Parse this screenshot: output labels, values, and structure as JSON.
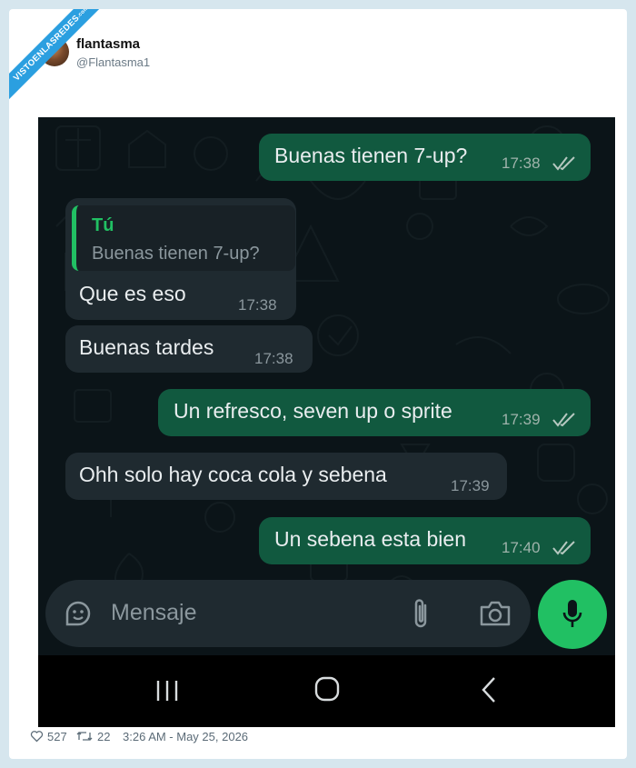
{
  "watermark": {
    "text": "VISTOENLASREDES",
    "suffix": ".com"
  },
  "tweet": {
    "author_name": "flantasma",
    "author_handle": "@Flantasma1",
    "likes": "527",
    "retweets": "22",
    "timestamp": "3:26 AM - May 25, 2026"
  },
  "chat": {
    "messages": [
      {
        "text": "Buenas tienen 7-up?",
        "time": "17:38",
        "direction": "outgoing",
        "status": "read"
      },
      {
        "text": "Que es eso",
        "time": "17:38",
        "direction": "incoming",
        "quote_author": "Tú",
        "quote_text": "Buenas tienen 7-up?"
      },
      {
        "text": "Buenas tardes",
        "time": "17:38",
        "direction": "incoming"
      },
      {
        "text": "Un refresco, seven up o sprite",
        "time": "17:39",
        "direction": "outgoing",
        "status": "read"
      },
      {
        "text": "Ohh solo hay coca cola y sebena",
        "time": "17:39",
        "direction": "incoming"
      },
      {
        "text": "Un sebena esta bien",
        "time": "17:40",
        "direction": "outgoing",
        "status": "read"
      }
    ],
    "input_placeholder": "Mensaje",
    "colors": {
      "outgoing_bubble": "#11593f",
      "incoming_bubble": "#1f2a30",
      "accent": "#21c063",
      "background": "#0b1418",
      "read_ticks": "#9fb3ab"
    }
  },
  "icons": [
    "sticker-icon",
    "attach-icon",
    "camera-icon",
    "mic-icon",
    "nav-recents-icon",
    "nav-home-icon",
    "nav-back-icon",
    "heart-icon",
    "retweet-icon"
  ]
}
